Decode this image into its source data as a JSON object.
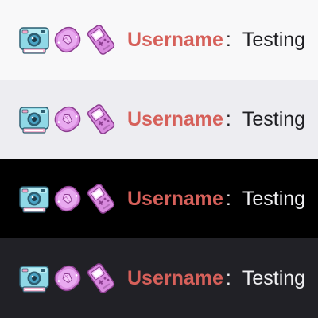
{
  "theme": {
    "username_color": "#d6605a"
  },
  "rows": [
    {
      "theme": "light",
      "background": "#f8f8f9",
      "text_color": "#1f1f23",
      "badges": [
        "camera-badge",
        "gem-badge",
        "handheld-console-badge"
      ],
      "username": "Username",
      "separator": ":",
      "message": "Testing"
    },
    {
      "theme": "light-gray",
      "background": "#ededf1",
      "text_color": "#1f1f23",
      "badges": [
        "camera-badge",
        "gem-badge",
        "handheld-console-badge"
      ],
      "username": "Username",
      "separator": ":",
      "message": "Testing"
    },
    {
      "theme": "black",
      "background": "#000000",
      "text_color": "#efeff1",
      "badges": [
        "camera-badge",
        "gem-badge",
        "handheld-console-badge"
      ],
      "username": "Username",
      "separator": ":",
      "message": "Testing"
    },
    {
      "theme": "dark",
      "background": "#212126",
      "text_color": "#efeff1",
      "badges": [
        "camera-badge",
        "gem-badge",
        "handheld-console-badge"
      ],
      "username": "Username",
      "separator": ":",
      "message": "Testing"
    }
  ]
}
